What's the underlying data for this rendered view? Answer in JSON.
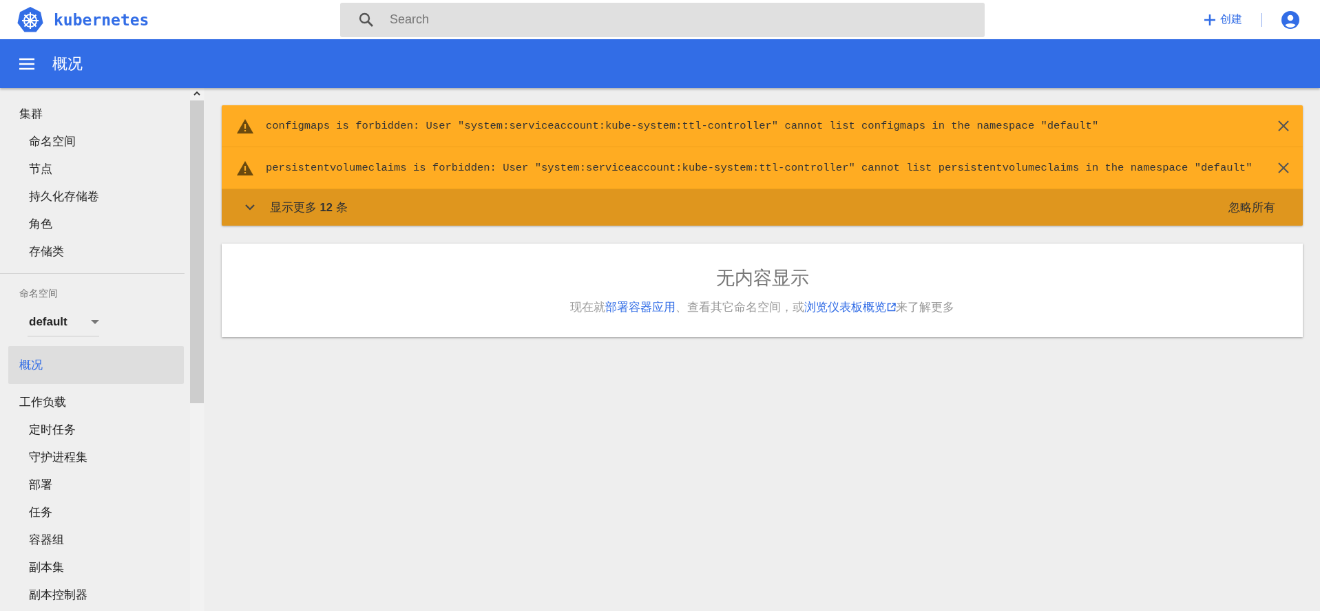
{
  "header": {
    "logo_text": "kubernetes",
    "search": {
      "placeholder": "Search"
    },
    "create_label": "创建"
  },
  "toolbar": {
    "title": "概况"
  },
  "sidebar": {
    "items": [
      {
        "kind": "heading",
        "label": "集群",
        "selected": false
      },
      {
        "kind": "sub",
        "label": "命名空间",
        "selected": false
      },
      {
        "kind": "sub",
        "label": "节点",
        "selected": false
      },
      {
        "kind": "sub",
        "label": "持久化存储卷",
        "selected": false
      },
      {
        "kind": "sub",
        "label": "角色",
        "selected": false
      },
      {
        "kind": "sub",
        "label": "存储类",
        "selected": false
      },
      {
        "kind": "divider"
      },
      {
        "kind": "field-label",
        "label": "命名空间"
      },
      {
        "kind": "select",
        "label": "default"
      },
      {
        "kind": "heading",
        "label": "概况",
        "selected": true
      },
      {
        "kind": "heading",
        "label": "工作负载",
        "selected": false
      },
      {
        "kind": "sub",
        "label": "定时任务",
        "selected": false
      },
      {
        "kind": "sub",
        "label": "守护进程集",
        "selected": false
      },
      {
        "kind": "sub",
        "label": "部署",
        "selected": false
      },
      {
        "kind": "sub",
        "label": "任务",
        "selected": false
      },
      {
        "kind": "sub",
        "label": "容器组",
        "selected": false
      },
      {
        "kind": "sub",
        "label": "副本集",
        "selected": false
      },
      {
        "kind": "sub",
        "label": "副本控制器",
        "selected": false
      }
    ]
  },
  "alerts": {
    "items": [
      {
        "message": "configmaps is forbidden: User \"system:serviceaccount:kube-system:ttl-controller\" cannot list configmaps in the namespace \"default\""
      },
      {
        "message": "persistentvolumeclaims is forbidden: User \"system:serviceaccount:kube-system:ttl-controller\" cannot list persistentvolumeclaims in the namespace \"default\""
      }
    ],
    "show_more": "显示更多 **12** 条",
    "dismiss_all": "忽略所有"
  },
  "empty_state": {
    "title": "无内容显示",
    "message": [
      {
        "kind": "text",
        "text": "现在就"
      },
      {
        "kind": "link",
        "text": "部署容器应用"
      },
      {
        "kind": "text",
        "text": "、查看其它命名空间，或"
      },
      {
        "kind": "external-link",
        "text": "浏览仪表板概览"
      },
      {
        "kind": "text",
        "text": "来了解更多"
      }
    ]
  }
}
